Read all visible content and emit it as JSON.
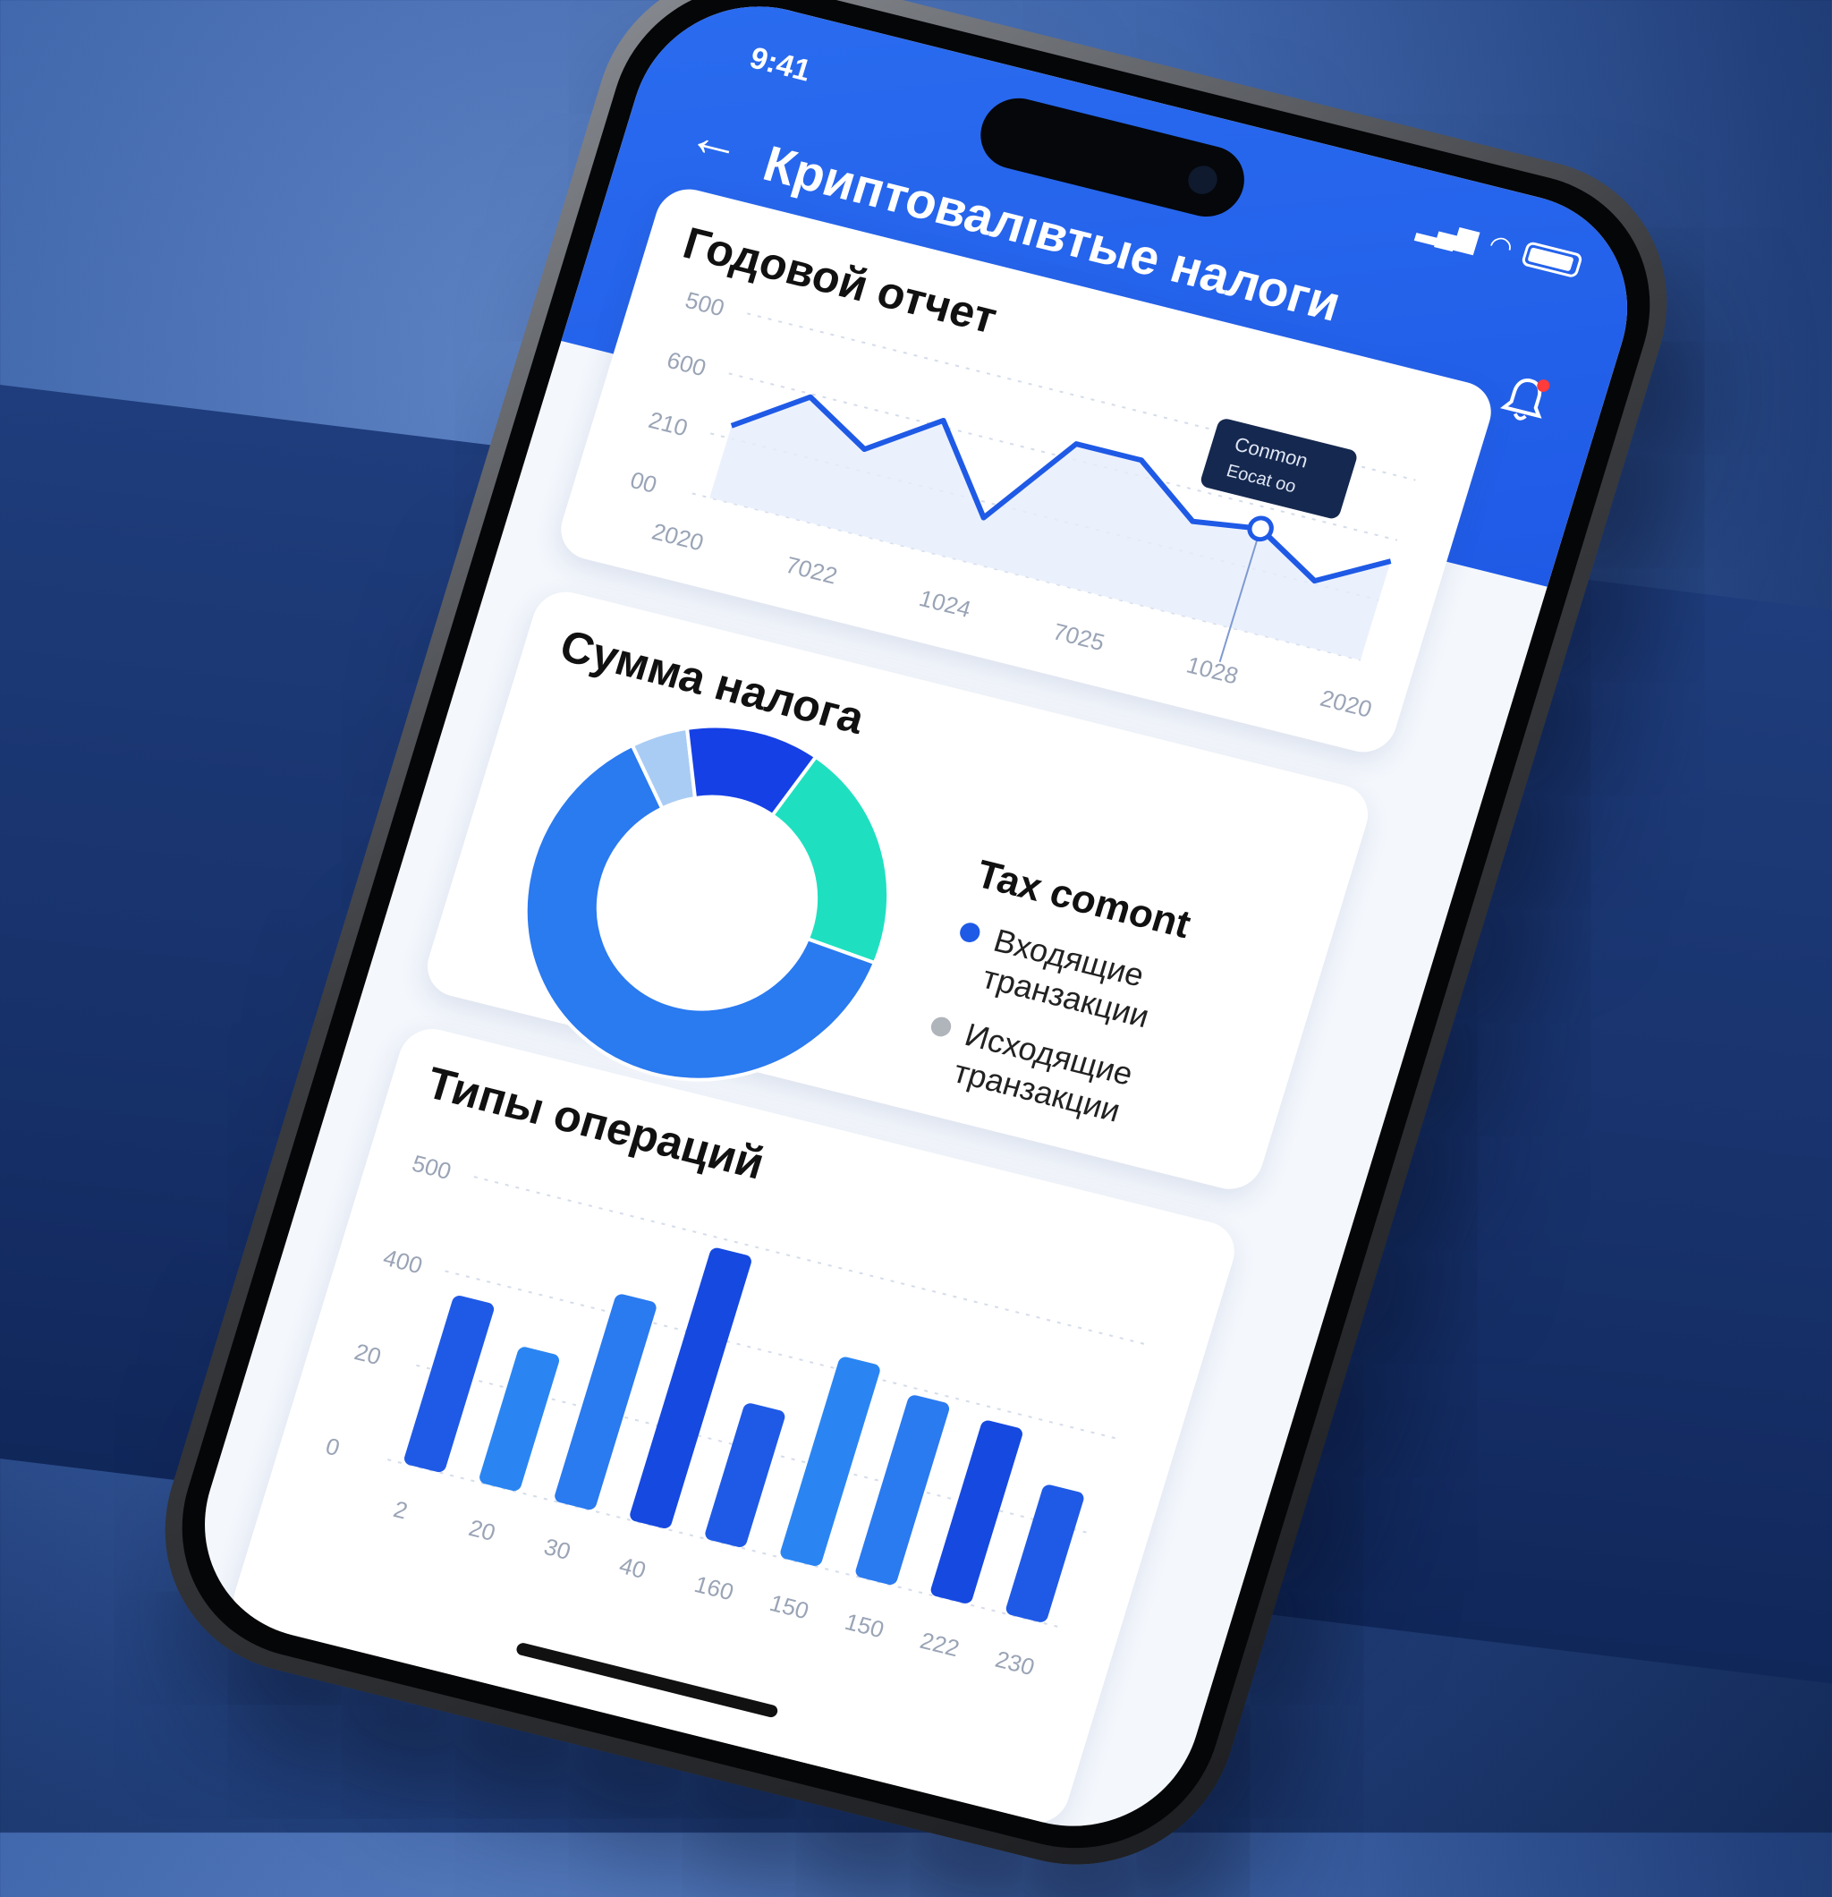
{
  "status": {
    "time": "9:41"
  },
  "header": {
    "title": "Криптовалıвтые налоги"
  },
  "card_annual": {
    "title": "Годовой отчет",
    "tooltip_line1": "Conmon",
    "tooltip_line2": "Eocat oo"
  },
  "card_sum": {
    "title": "Сумма налога",
    "legend_title": "Tax comont",
    "legend": [
      {
        "label": "Входящие транзакции",
        "color": "#1f5ae6"
      },
      {
        "label": "Исходящие транзакции",
        "color": "#b0b4bb"
      }
    ]
  },
  "card_types": {
    "title": "Типы операций"
  },
  "colors": {
    "accent": "#1f5ae6",
    "teal": "#1ee0c0",
    "light_blue": "#a9ccf5",
    "donut_main": "#2a7af0"
  },
  "chart_data": [
    {
      "type": "line",
      "title": "Годовой отчет",
      "y_ticks": [
        "500",
        "600",
        "210",
        "00"
      ],
      "x_ticks": [
        "2020",
        "7022",
        "1024",
        "7025",
        "1028",
        "2020"
      ],
      "values": [
        280,
        330,
        290,
        340,
        250,
        350,
        350,
        300,
        310,
        270,
        310
      ]
    },
    {
      "type": "pie",
      "title": "Сумма налога",
      "slices": [
        {
          "value": 62,
          "color": "#2a7af0"
        },
        {
          "value": 21,
          "color": "#1ee0c0"
        },
        {
          "value": 12,
          "color": "#1540e6"
        },
        {
          "value": 5,
          "color": "#a9ccf5"
        }
      ]
    },
    {
      "type": "bar",
      "title": "Типы операций",
      "y_ticks": [
        "500",
        "400",
        "20",
        "0"
      ],
      "categories": [
        "2",
        "20",
        "30",
        "40",
        "160",
        "150",
        "150",
        "222",
        "230"
      ],
      "values": [
        260,
        210,
        320,
        420,
        210,
        310,
        280,
        270,
        200
      ]
    }
  ]
}
